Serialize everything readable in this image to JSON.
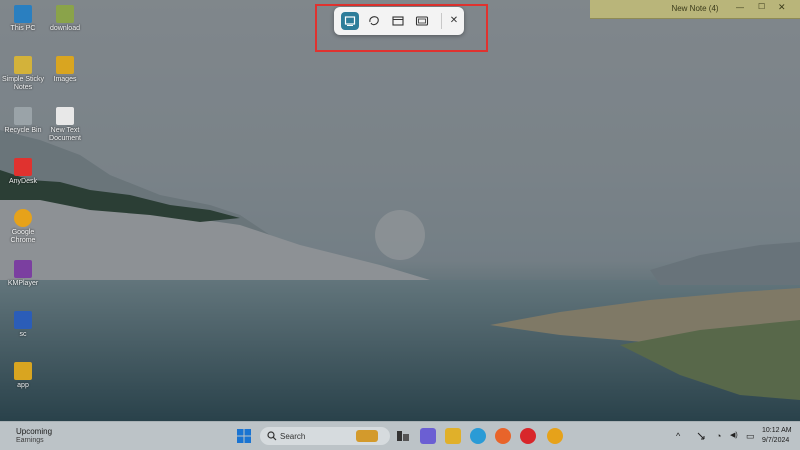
{
  "desktop": {
    "icons": [
      {
        "label": "This PC",
        "icon": "monitor-icon",
        "color": "#2a7fc0"
      },
      {
        "label": "download",
        "icon": "folder-icon",
        "color": "#8aa34a"
      },
      {
        "label": "Simple Sticky Notes",
        "icon": "sticky-notes-icon",
        "color": "#d3b23a"
      },
      {
        "label": "Images",
        "icon": "folder-icon",
        "color": "#d9a520"
      },
      {
        "label": "Recycle Bin",
        "icon": "recycle-bin-icon",
        "color": "#9aa3a8"
      },
      {
        "label": "New Text Document",
        "icon": "document-icon",
        "color": "#e8e8e8"
      },
      {
        "label": "AnyDesk",
        "icon": "anydesk-icon",
        "color": "#e0322f"
      },
      {
        "label": "Google Chrome",
        "icon": "chrome-icon",
        "color": "#e6a21a"
      },
      {
        "label": "KMPlayer",
        "icon": "kmplayer-icon",
        "color": "#7b3fa0"
      },
      {
        "label": "sc",
        "icon": "word-document-icon",
        "color": "#2b5db8"
      },
      {
        "label": "app",
        "icon": "folder-icon",
        "color": "#d9a520"
      }
    ]
  },
  "snipping_toolbar": {
    "modes": [
      {
        "name": "rectangle-mode",
        "icon": "rectangle-snip-icon",
        "active": true
      },
      {
        "name": "freeform-mode",
        "icon": "freeform-snip-icon",
        "active": false
      },
      {
        "name": "window-mode",
        "icon": "window-snip-icon",
        "active": false
      },
      {
        "name": "fullscreen-mode",
        "icon": "fullscreen-snip-icon",
        "active": false
      }
    ],
    "close_icon": "close-icon",
    "close_glyph": "✕",
    "highlight_color": "#e0322f"
  },
  "sticky_note": {
    "title": "New Note (4)",
    "minimize_glyph": "—",
    "maximize_glyph": "☐",
    "close_glyph": "✕"
  },
  "taskbar": {
    "weather_title": "Upcoming",
    "weather_subtitle": "Earnings",
    "search_placeholder": "Search",
    "apps": [
      {
        "name": "task-view-icon",
        "color": "#333333"
      },
      {
        "name": "meet-icon",
        "color": "#6b5fd3"
      },
      {
        "name": "file-explorer-icon",
        "color": "#e0b02a"
      },
      {
        "name": "edge-icon",
        "color": "#2a9bd6"
      },
      {
        "name": "firefox-icon",
        "color": "#e8642a"
      },
      {
        "name": "opera-icon",
        "color": "#d8262b"
      },
      {
        "name": "chrome-icon",
        "color": "#e6a21a"
      }
    ],
    "tray": {
      "chevron_glyph": "^",
      "wifi_glyph": "◔",
      "volume_glyph": "◀)",
      "battery_glyph": "▭"
    },
    "time": "10:12 AM",
    "date": "9/7/2024"
  }
}
